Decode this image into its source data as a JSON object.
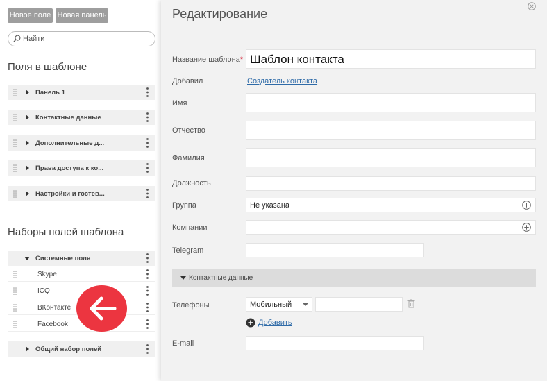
{
  "toolbar": {
    "new_field": "Новое поле",
    "new_panel": "Новая панель"
  },
  "search": {
    "placeholder": "Найти"
  },
  "fields_section": {
    "title": "Поля в шаблоне",
    "items": [
      {
        "label": "Панель 1"
      },
      {
        "label": "Контактные данные"
      },
      {
        "label": "Дополнительные д..."
      },
      {
        "label": "Права доступа к ко..."
      },
      {
        "label": "Настройки и гостев..."
      }
    ]
  },
  "sets_section": {
    "title": "Наборы полей шаблона",
    "system": {
      "label": "Системные поля",
      "items": [
        "Skype",
        "ICQ",
        "ВКонтакте",
        "Facebook"
      ]
    },
    "common": {
      "label": "Общий набор полей"
    }
  },
  "editor": {
    "title": "Редактирование",
    "template_name": {
      "label": "Название шаблона",
      "required": "*",
      "value": "Шаблон контакта"
    },
    "added_by": {
      "label": "Добавил",
      "value": "Создатель контакта"
    },
    "first_name": {
      "label": "Имя"
    },
    "patronymic": {
      "label": "Отчество"
    },
    "last_name": {
      "label": "Фамилия"
    },
    "position": {
      "label": "Должность"
    },
    "group": {
      "label": "Группа",
      "value": "Не указана"
    },
    "companies": {
      "label": "Компании"
    },
    "telegram": {
      "label": "Telegram"
    },
    "contact_group": {
      "label": "Контактные данные"
    },
    "phones": {
      "label": "Телефоны",
      "type": "Мобильный",
      "add": "Добавить"
    },
    "email": {
      "label": "E-mail"
    }
  },
  "colors": {
    "accent_red": "#ec3540",
    "link": "#2f6ba8",
    "button_gray": "#9e9e9e"
  }
}
